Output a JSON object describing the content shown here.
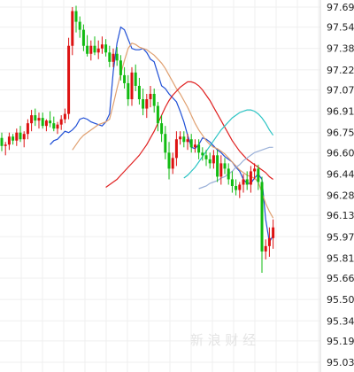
{
  "chart_data": {
    "type": "candlestick",
    "ylim": [
      95.03,
      97.74
    ],
    "y_ticks": [
      "97.69",
      "97.54",
      "97.38",
      "97.22",
      "97.07",
      "96.91",
      "96.75",
      "96.60",
      "96.44",
      "96.28",
      "96.13",
      "95.97",
      "95.81",
      "95.66",
      "95.50",
      "95.34",
      "95.19",
      "95.03"
    ],
    "grid": true,
    "up_color": "#dd1111",
    "down_color": "#11bb11",
    "candles": [
      [
        96.71,
        96.75,
        96.61,
        96.65
      ],
      [
        96.65,
        96.68,
        96.58,
        96.66
      ],
      [
        96.66,
        96.75,
        96.62,
        96.72
      ],
      [
        96.72,
        96.74,
        96.66,
        96.69
      ],
      [
        96.69,
        96.78,
        96.65,
        96.75
      ],
      [
        96.75,
        96.8,
        96.68,
        96.7
      ],
      [
        96.7,
        96.76,
        96.64,
        96.74
      ],
      [
        96.74,
        96.85,
        96.7,
        96.82
      ],
      [
        96.82,
        96.92,
        96.76,
        96.88
      ],
      [
        96.88,
        96.93,
        96.8,
        96.84
      ],
      [
        96.84,
        96.9,
        96.78,
        96.86
      ],
      [
        96.86,
        96.9,
        96.78,
        96.8
      ],
      [
        96.8,
        96.85,
        96.76,
        96.84
      ],
      [
        96.84,
        96.91,
        96.79,
        96.82
      ],
      [
        96.82,
        96.87,
        96.76,
        96.78
      ],
      [
        96.78,
        96.83,
        96.74,
        96.81
      ],
      [
        96.81,
        96.88,
        96.77,
        96.85
      ],
      [
        96.85,
        96.93,
        96.82,
        96.89
      ],
      [
        96.89,
        97.46,
        96.85,
        97.4
      ],
      [
        97.4,
        97.69,
        97.33,
        97.66
      ],
      [
        97.66,
        97.7,
        97.5,
        97.58
      ],
      [
        97.58,
        97.62,
        97.46,
        97.52
      ],
      [
        97.52,
        97.56,
        97.36,
        97.4
      ],
      [
        97.4,
        97.48,
        97.32,
        97.34
      ],
      [
        97.34,
        97.44,
        97.29,
        97.4
      ],
      [
        97.4,
        97.47,
        97.33,
        97.35
      ],
      [
        97.35,
        97.44,
        97.3,
        97.38
      ],
      [
        97.38,
        97.47,
        97.34,
        97.41
      ],
      [
        97.41,
        97.45,
        97.32,
        97.35
      ],
      [
        97.35,
        97.4,
        97.24,
        97.28
      ],
      [
        97.28,
        97.38,
        97.24,
        97.34
      ],
      [
        97.34,
        97.39,
        97.25,
        97.29
      ],
      [
        97.29,
        97.33,
        97.14,
        97.18
      ],
      [
        97.18,
        97.24,
        97.08,
        97.12
      ],
      [
        97.12,
        97.18,
        96.95,
        97.0
      ],
      [
        97.0,
        97.24,
        96.95,
        97.2
      ],
      [
        97.2,
        97.26,
        97.06,
        97.1
      ],
      [
        97.1,
        97.16,
        96.96,
        97.0
      ],
      [
        97.0,
        97.08,
        96.88,
        96.93
      ],
      [
        96.93,
        97.04,
        96.86,
        97.0
      ],
      [
        97.0,
        97.1,
        96.94,
        97.04
      ],
      [
        97.04,
        97.08,
        96.9,
        96.95
      ],
      [
        96.95,
        96.98,
        96.76,
        96.82
      ],
      [
        96.82,
        96.88,
        96.68,
        96.74
      ],
      [
        96.74,
        96.8,
        96.55,
        96.6
      ],
      [
        96.6,
        96.68,
        96.4,
        96.48
      ],
      [
        96.48,
        96.6,
        96.44,
        96.56
      ],
      [
        96.56,
        96.76,
        96.5,
        96.7
      ],
      [
        96.7,
        96.76,
        96.66,
        96.72
      ],
      [
        96.72,
        96.76,
        96.64,
        96.68
      ],
      [
        96.68,
        96.74,
        96.62,
        96.7
      ],
      [
        96.7,
        96.74,
        96.6,
        96.64
      ],
      [
        96.64,
        96.7,
        96.6,
        96.66
      ],
      [
        96.66,
        96.7,
        96.55,
        96.6
      ],
      [
        96.6,
        96.64,
        96.54,
        96.58
      ],
      [
        96.58,
        96.62,
        96.5,
        96.55
      ],
      [
        96.55,
        96.6,
        96.48,
        96.52
      ],
      [
        96.52,
        96.62,
        96.48,
        96.58
      ],
      [
        96.58,
        96.62,
        96.38,
        96.42
      ],
      [
        96.42,
        96.58,
        96.36,
        96.52
      ],
      [
        96.52,
        96.56,
        96.44,
        96.48
      ],
      [
        96.48,
        96.52,
        96.36,
        96.4
      ],
      [
        96.4,
        96.46,
        96.3,
        96.35
      ],
      [
        96.35,
        96.4,
        96.28,
        96.32
      ],
      [
        96.32,
        96.38,
        96.26,
        96.36
      ],
      [
        96.36,
        96.44,
        96.3,
        96.4
      ],
      [
        96.4,
        96.46,
        96.32,
        96.36
      ],
      [
        96.36,
        96.5,
        96.3,
        96.46
      ],
      [
        96.46,
        96.52,
        96.4,
        96.48
      ],
      [
        96.48,
        96.51,
        96.32,
        96.38
      ],
      [
        96.38,
        96.42,
        95.7,
        95.86
      ],
      [
        95.86,
        95.95,
        95.8,
        95.9
      ],
      [
        95.9,
        96.04,
        95.82,
        95.96
      ],
      [
        95.96,
        96.1,
        95.88,
        96.04
      ]
    ],
    "ma_lines": [
      {
        "color": "#1f4fd6",
        "values": [
          96.66,
          96.69,
          96.7,
          96.73,
          96.76,
          96.75,
          96.77,
          96.8,
          96.85,
          96.86,
          96.85,
          96.83,
          96.82,
          96.81,
          96.8,
          96.83,
          96.89,
          97.21,
          97.42,
          97.54,
          97.52,
          97.45,
          97.38,
          97.37,
          97.37,
          97.38,
          97.35,
          97.3,
          97.28,
          97.19,
          97.1,
          97.08,
          97.04,
          97.01,
          96.98,
          96.91,
          96.83,
          96.73,
          96.64,
          96.63,
          96.66,
          96.71,
          96.7,
          96.68,
          96.65,
          96.62,
          96.6,
          96.57,
          96.55,
          96.53,
          96.49,
          96.46,
          96.4,
          96.37,
          96.37,
          96.41,
          96.44,
          96.4,
          96.1,
          95.93,
          95.98
        ]
      },
      {
        "color": "#e0a070",
        "values": [
          96.62,
          96.66,
          96.7,
          96.73,
          96.75,
          96.77,
          96.79,
          96.81,
          96.82,
          96.83,
          96.85,
          96.96,
          97.08,
          97.19,
          97.29,
          97.38,
          97.42,
          97.41,
          97.39,
          97.38,
          97.37,
          97.35,
          97.33,
          97.3,
          97.27,
          97.23,
          97.18,
          97.13,
          97.08,
          97.04,
          96.99,
          96.94,
          96.88,
          96.82,
          96.77,
          96.73,
          96.69,
          96.66,
          96.64,
          96.63,
          96.61,
          96.59,
          96.56,
          96.53,
          96.5,
          96.47,
          96.45,
          96.43,
          96.42,
          96.41,
          96.38,
          96.3,
          96.22,
          96.16,
          96.11
        ]
      },
      {
        "color": "#e02020",
        "values": [
          96.34,
          96.36,
          96.38,
          96.4,
          96.43,
          96.46,
          96.49,
          96.52,
          96.55,
          96.58,
          96.62,
          96.66,
          96.71,
          96.76,
          96.82,
          96.88,
          96.94,
          96.99,
          97.03,
          97.06,
          97.09,
          97.11,
          97.13,
          97.13,
          97.12,
          97.1,
          97.07,
          97.03,
          96.99,
          96.94,
          96.89,
          96.84,
          96.79,
          96.74,
          96.69,
          96.65,
          96.61,
          96.58,
          96.55,
          96.53,
          96.51,
          96.49,
          96.47,
          96.45,
          96.42,
          96.4
        ]
      },
      {
        "color": "#2cc4c4",
        "values": [
          96.41,
          96.43,
          96.46,
          96.49,
          96.53,
          96.57,
          96.61,
          96.65,
          96.69,
          96.73,
          96.77,
          96.8,
          96.83,
          96.86,
          96.88,
          96.9,
          96.91,
          96.92,
          96.92,
          96.91,
          96.89,
          96.86,
          96.82,
          96.77,
          96.73
        ]
      },
      {
        "color": "#9ab0d8",
        "values": [
          96.33,
          96.34,
          96.35,
          96.37,
          96.38,
          96.39,
          96.41,
          96.42,
          96.44,
          96.46,
          96.49,
          96.51,
          96.54,
          96.56,
          96.58,
          96.6,
          96.61,
          96.62,
          96.63,
          96.64,
          96.64
        ]
      }
    ]
  },
  "watermark": "新 浪 财 经"
}
